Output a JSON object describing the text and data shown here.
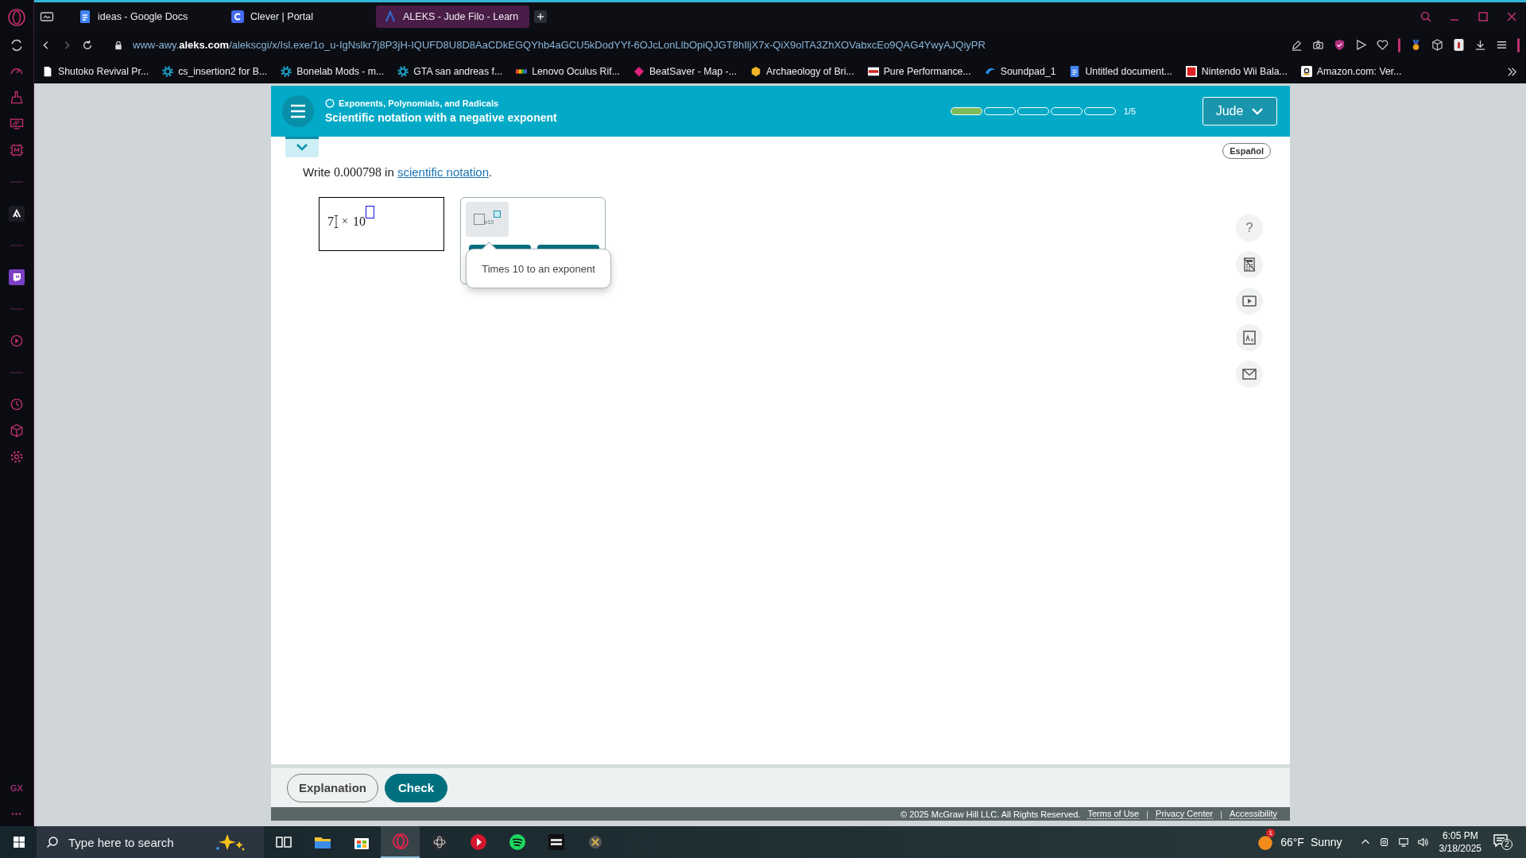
{
  "sidebar": {
    "brand": "GX",
    "more": "•••"
  },
  "tabs": [
    {
      "title": "ideas - Google Docs",
      "kind": "docs",
      "selected": false
    },
    {
      "title": "Clever | Portal",
      "kind": "clever",
      "selected": false
    },
    {
      "title": "ALEKS - Jude Filo - Learn",
      "kind": "aleks",
      "selected": true
    }
  ],
  "address_bar": {
    "url": "www-awy.**aleks.com**/alekscgi/x/Isl.exe/1o_u-IgNslkr7j8P3jH-IQUFD8U8D8AaCDkEGQYhb4aGCU5kDodYYf-6OJcLonLlbOpiQJGT8hIljX7x-QiX9olTA3ZhXOVabxcEo9QAG4YwyAJQiyPR"
  },
  "bookmarks": [
    {
      "title": "Shutoko Revival Pr...",
      "kind": "page"
    },
    {
      "title": "cs_insertion2 for B...",
      "kind": "gear"
    },
    {
      "title": "Bonelab Mods - m...",
      "kind": "gear"
    },
    {
      "title": "GTA san andreas f...",
      "kind": "gear"
    },
    {
      "title": "Lenovo Oculus Rif...",
      "kind": "bars"
    },
    {
      "title": "BeatSaver - Map -...",
      "kind": "diamond"
    },
    {
      "title": "Archaeology of Bri...",
      "kind": "hexagon"
    },
    {
      "title": "Pure Performance...",
      "kind": "banner"
    },
    {
      "title": "Soundpad_1",
      "kind": "swoosh"
    },
    {
      "title": "Untitled document...",
      "kind": "docs"
    },
    {
      "title": "Nintendo Wii Bala...",
      "kind": "red"
    },
    {
      "title": "Amazon.com: Ver...",
      "kind": "dark"
    }
  ],
  "aleks": {
    "topic": "Exponents, Polynomials, and Radicals",
    "title": "Scientific notation with a negative exponent",
    "progress": {
      "segments": [
        {
          "filled": true
        },
        {
          "filled": false
        },
        {
          "filled": false
        },
        {
          "filled": false
        },
        {
          "filled": false
        }
      ],
      "label": "1/5"
    },
    "user": "Jude",
    "language": "Español",
    "question": {
      "before": "Write",
      "value": "0.000798",
      "mid": "in",
      "link": "scientific notation",
      "after": "."
    },
    "answer": {
      "mantissa": "7",
      "operator": "×",
      "base": "10"
    },
    "palette": {
      "template_label": "x10",
      "tooltip": "Times 10 to an exponent"
    },
    "help_glyph": "?",
    "buttons": [
      {
        "label": "Explanation",
        "kind": "secondary"
      },
      {
        "label": "Check",
        "kind": "primary"
      }
    ],
    "footer": {
      "copyright": "© 2025 McGraw Hill LLC. All Rights Reserved.",
      "links": [
        "Terms of Use",
        "Privacy Center",
        "Accessibility"
      ],
      "separators": [
        "|",
        "|"
      ]
    }
  },
  "taskbar": {
    "search": {
      "placeholder": "Type here to search"
    },
    "apps": [
      {
        "kind": "task-view",
        "active": false
      },
      {
        "kind": "folder",
        "active": false
      },
      {
        "kind": "store",
        "active": false
      },
      {
        "kind": "opera",
        "active": true
      },
      {
        "kind": "orbit",
        "active": false
      },
      {
        "kind": "play",
        "active": false
      },
      {
        "kind": "spotify",
        "active": false
      },
      {
        "kind": "black",
        "active": false
      },
      {
        "kind": "cross",
        "active": false
      }
    ],
    "weather": {
      "temperature": "66°F",
      "condition": "Sunny",
      "badge": "1"
    },
    "time": "6:05 PM",
    "date": "3/18/2025",
    "notifications": "2"
  }
}
